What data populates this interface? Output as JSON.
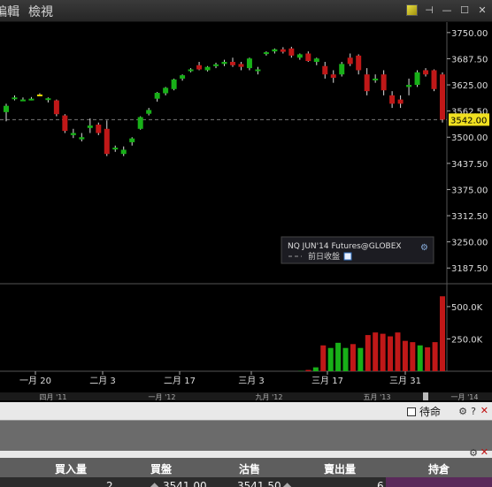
{
  "menu": {
    "tab1": "編輯",
    "tab2": "檢視"
  },
  "window": {
    "pin_icon": "pin-icon",
    "minimize": "—",
    "maximize": "☐",
    "close": "✕"
  },
  "chart_data": {
    "type": "candlestick",
    "instrument_label": "NQ JUN'14 Futures@GLOBEX",
    "legend_sub": "前日收盤",
    "current_price": "3542.00",
    "price_ticks": [
      "3750.00",
      "3687.50",
      "3625.00",
      "3562.50",
      "3500.00",
      "3437.50",
      "3375.00",
      "3312.50",
      "3250.00",
      "3187.50"
    ],
    "volume_ticks": [
      "500.0K",
      "250.0K"
    ],
    "x_ticks": [
      "一月 20",
      "二月 3",
      "二月 17",
      "三月 3",
      "三月 17",
      "三月 31"
    ],
    "timeline_ticks": [
      "四月 '11",
      "一月 '12",
      "九月 '12",
      "五月 '13",
      "一月 '14"
    ],
    "candles": [
      {
        "o": 3560,
        "h": 3580,
        "l": 3538,
        "c": 3575,
        "dir": "up"
      },
      {
        "o": 3595,
        "h": 3600,
        "l": 3588,
        "c": 3593,
        "dir": "up"
      },
      {
        "o": 3590,
        "h": 3595,
        "l": 3586,
        "c": 3590,
        "dir": "up"
      },
      {
        "o": 3592,
        "h": 3596,
        "l": 3588,
        "c": 3590,
        "dir": "up"
      },
      {
        "o": 3600,
        "h": 3605,
        "l": 3600,
        "c": 3602,
        "dir": "yellow"
      },
      {
        "o": 3590,
        "h": 3595,
        "l": 3583,
        "c": 3593,
        "dir": "up"
      },
      {
        "o": 3588,
        "h": 3590,
        "l": 3550,
        "c": 3555,
        "dir": "down"
      },
      {
        "o": 3552,
        "h": 3555,
        "l": 3510,
        "c": 3515,
        "dir": "down"
      },
      {
        "o": 3510,
        "h": 3520,
        "l": 3498,
        "c": 3505,
        "dir": "up"
      },
      {
        "o": 3500,
        "h": 3510,
        "l": 3490,
        "c": 3495,
        "dir": "up"
      },
      {
        "o": 3522,
        "h": 3545,
        "l": 3510,
        "c": 3528,
        "dir": "up"
      },
      {
        "o": 3530,
        "h": 3535,
        "l": 3505,
        "c": 3510,
        "dir": "down"
      },
      {
        "o": 3520,
        "h": 3540,
        "l": 3455,
        "c": 3460,
        "dir": "down"
      },
      {
        "o": 3475,
        "h": 3480,
        "l": 3465,
        "c": 3472,
        "dir": "up"
      },
      {
        "o": 3470,
        "h": 3478,
        "l": 3455,
        "c": 3460,
        "dir": "up"
      },
      {
        "o": 3488,
        "h": 3500,
        "l": 3480,
        "c": 3497,
        "dir": "up"
      },
      {
        "o": 3520,
        "h": 3550,
        "l": 3518,
        "c": 3548,
        "dir": "up"
      },
      {
        "o": 3556,
        "h": 3570,
        "l": 3552,
        "c": 3565,
        "dir": "up"
      },
      {
        "o": 3592,
        "h": 3608,
        "l": 3585,
        "c": 3606,
        "dir": "up"
      },
      {
        "o": 3605,
        "h": 3620,
        "l": 3600,
        "c": 3618,
        "dir": "up"
      },
      {
        "o": 3615,
        "h": 3640,
        "l": 3612,
        "c": 3638,
        "dir": "up"
      },
      {
        "o": 3640,
        "h": 3650,
        "l": 3635,
        "c": 3648,
        "dir": "up"
      },
      {
        "o": 3658,
        "h": 3665,
        "l": 3655,
        "c": 3662,
        "dir": "up"
      },
      {
        "o": 3672,
        "h": 3680,
        "l": 3660,
        "c": 3662,
        "dir": "down"
      },
      {
        "o": 3660,
        "h": 3670,
        "l": 3657,
        "c": 3668,
        "dir": "up"
      },
      {
        "o": 3670,
        "h": 3678,
        "l": 3665,
        "c": 3674,
        "dir": "up"
      },
      {
        "o": 3675,
        "h": 3685,
        "l": 3670,
        "c": 3680,
        "dir": "up"
      },
      {
        "o": 3680,
        "h": 3690,
        "l": 3668,
        "c": 3672,
        "dir": "down"
      },
      {
        "o": 3668,
        "h": 3680,
        "l": 3660,
        "c": 3675,
        "dir": "down"
      },
      {
        "o": 3665,
        "h": 3690,
        "l": 3660,
        "c": 3688,
        "dir": "up"
      },
      {
        "o": 3660,
        "h": 3668,
        "l": 3650,
        "c": 3662,
        "dir": "up"
      },
      {
        "o": 3700,
        "h": 3705,
        "l": 3695,
        "c": 3703,
        "dir": "up"
      },
      {
        "o": 3705,
        "h": 3712,
        "l": 3700,
        "c": 3710,
        "dir": "up"
      },
      {
        "o": 3710,
        "h": 3715,
        "l": 3700,
        "c": 3704,
        "dir": "down"
      },
      {
        "o": 3712,
        "h": 3716,
        "l": 3690,
        "c": 3695,
        "dir": "down"
      },
      {
        "o": 3690,
        "h": 3700,
        "l": 3685,
        "c": 3698,
        "dir": "up"
      },
      {
        "o": 3700,
        "h": 3705,
        "l": 3680,
        "c": 3682,
        "dir": "down"
      },
      {
        "o": 3680,
        "h": 3690,
        "l": 3672,
        "c": 3688,
        "dir": "up"
      },
      {
        "o": 3670,
        "h": 3680,
        "l": 3640,
        "c": 3650,
        "dir": "down"
      },
      {
        "o": 3642,
        "h": 3660,
        "l": 3630,
        "c": 3650,
        "dir": "down"
      },
      {
        "o": 3650,
        "h": 3680,
        "l": 3645,
        "c": 3675,
        "dir": "up"
      },
      {
        "o": 3690,
        "h": 3700,
        "l": 3670,
        "c": 3675,
        "dir": "down"
      },
      {
        "o": 3695,
        "h": 3698,
        "l": 3650,
        "c": 3660,
        "dir": "down"
      },
      {
        "o": 3650,
        "h": 3665,
        "l": 3600,
        "c": 3610,
        "dir": "down"
      },
      {
        "o": 3640,
        "h": 3650,
        "l": 3630,
        "c": 3640,
        "dir": "up"
      },
      {
        "o": 3650,
        "h": 3660,
        "l": 3600,
        "c": 3612,
        "dir": "down"
      },
      {
        "o": 3600,
        "h": 3610,
        "l": 3570,
        "c": 3580,
        "dir": "down"
      },
      {
        "o": 3590,
        "h": 3600,
        "l": 3570,
        "c": 3580,
        "dir": "down"
      },
      {
        "o": 3620,
        "h": 3640,
        "l": 3600,
        "c": 3625,
        "dir": "up"
      },
      {
        "o": 3625,
        "h": 3660,
        "l": 3620,
        "c": 3655,
        "dir": "up"
      },
      {
        "o": 3660,
        "h": 3665,
        "l": 3645,
        "c": 3650,
        "dir": "down"
      },
      {
        "o": 3660,
        "h": 3662,
        "l": 3610,
        "c": 3615,
        "dir": "down"
      },
      {
        "o": 3650,
        "h": 3655,
        "l": 3535,
        "c": 3542,
        "dir": "down"
      }
    ],
    "volumes": [
      {
        "v": 2,
        "dir": "up"
      },
      {
        "v": 10,
        "dir": "down"
      },
      {
        "v": 30,
        "dir": "up"
      },
      {
        "v": 200,
        "dir": "down"
      },
      {
        "v": 180,
        "dir": "up"
      },
      {
        "v": 220,
        "dir": "up"
      },
      {
        "v": 180,
        "dir": "up"
      },
      {
        "v": 210,
        "dir": "down"
      },
      {
        "v": 180,
        "dir": "up"
      },
      {
        "v": 280,
        "dir": "down"
      },
      {
        "v": 300,
        "dir": "down"
      },
      {
        "v": 290,
        "dir": "down"
      },
      {
        "v": 270,
        "dir": "down"
      },
      {
        "v": 300,
        "dir": "down"
      },
      {
        "v": 235,
        "dir": "down"
      },
      {
        "v": 225,
        "dir": "down"
      },
      {
        "v": 200,
        "dir": "up"
      },
      {
        "v": 185,
        "dir": "down"
      },
      {
        "v": 225,
        "dir": "down"
      },
      {
        "v": 580,
        "dir": "down"
      }
    ]
  },
  "orders": {
    "pending_label": "待命",
    "headers": {
      "buy_qty": "買入量",
      "bid": "買盤",
      "ask": "沽售",
      "sell_qty": "賣出量",
      "position": "持倉"
    },
    "row": {
      "buy_qty": "2",
      "bid": "3541.00",
      "ask": "3541.50",
      "sell_qty": "6"
    }
  },
  "colors": {
    "up": "#18b018",
    "down": "#c01818",
    "yellow": "#e8d800",
    "accent": "#f0e020"
  }
}
